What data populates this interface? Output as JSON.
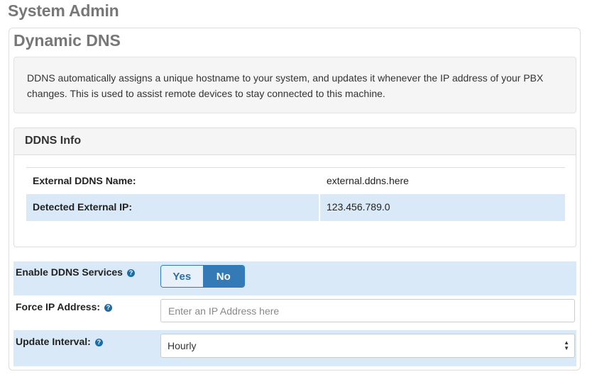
{
  "header": {
    "title": "System Admin"
  },
  "module": {
    "title": "Dynamic DNS",
    "description": "DDNS automatically assigns a unique hostname to your system, and updates it whenever the IP address of your PBX changes. This is used to assist remote devices to stay connected to this machine."
  },
  "ddns_info": {
    "heading": "DDNS Info",
    "rows": [
      {
        "label": "External DDNS Name:",
        "value": "external.ddns.here"
      },
      {
        "label": "Detected External IP:",
        "value": "123.456.789.0"
      }
    ]
  },
  "form": {
    "enable": {
      "label": "Enable DDNS Services",
      "yes": "Yes",
      "no": "No",
      "selected": "No"
    },
    "force_ip": {
      "label": "Force IP Address:",
      "placeholder": "Enter an IP Address here",
      "value": ""
    },
    "interval": {
      "label": "Update Interval:",
      "selected": "Hourly"
    }
  },
  "icons": {
    "help": "question-circle-icon",
    "select_arrows": "updown-arrows-icon"
  },
  "colors": {
    "primary": "#337ab7",
    "row_highlight": "#d9e9f7",
    "title_gray": "#777777"
  }
}
